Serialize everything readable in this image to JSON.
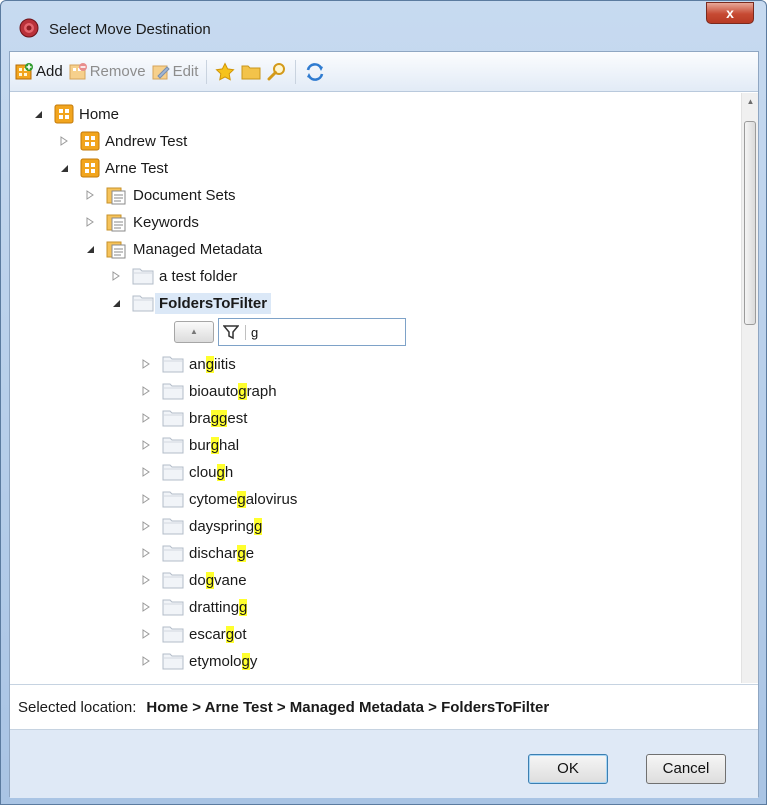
{
  "window": {
    "title": "Select Move Destination",
    "close_glyph": "x"
  },
  "toolbar": {
    "add_label": "Add",
    "remove_label": "Remove",
    "edit_label": "Edit"
  },
  "tree": {
    "home": "Home",
    "andrew_test": "Andrew Test",
    "arne_test": "Arne Test",
    "document_sets": "Document Sets",
    "keywords": "Keywords",
    "managed_metadata": "Managed Metadata",
    "a_test_folder": "a test folder",
    "folders_to_filter": "FoldersToFilter",
    "filter_value": "g",
    "children": [
      {
        "pre": "an",
        "hl": "g",
        "post": "iitis"
      },
      {
        "pre": "bioauto",
        "hl": "g",
        "post": "raph"
      },
      {
        "pre": "bra",
        "hl": "gg",
        "post": "est"
      },
      {
        "pre": "bur",
        "hl": "g",
        "post": "hal"
      },
      {
        "pre": "clou",
        "hl": "g",
        "post": "h"
      },
      {
        "pre": "cytome",
        "hl": "g",
        "post": "alovirus"
      },
      {
        "pre": "dayspring",
        "hl": "g",
        "post": ""
      },
      {
        "pre": "dischar",
        "hl": "g",
        "post": "e"
      },
      {
        "pre": "do",
        "hl": "g",
        "post": "vane"
      },
      {
        "pre": "dratting",
        "hl": "g",
        "post": ""
      },
      {
        "pre": "escar",
        "hl": "g",
        "post": "ot"
      },
      {
        "pre": "etymolo",
        "hl": "g",
        "post": "y"
      }
    ]
  },
  "status": {
    "label": "Selected location:",
    "path": "Home > Arne Test > Managed Metadata > FoldersToFilter"
  },
  "buttons": {
    "ok": "OK",
    "cancel": "Cancel"
  },
  "colors": {
    "highlight": "#ffff2e",
    "selection": "#dbe8f7",
    "footer": "#dfe9f6"
  }
}
